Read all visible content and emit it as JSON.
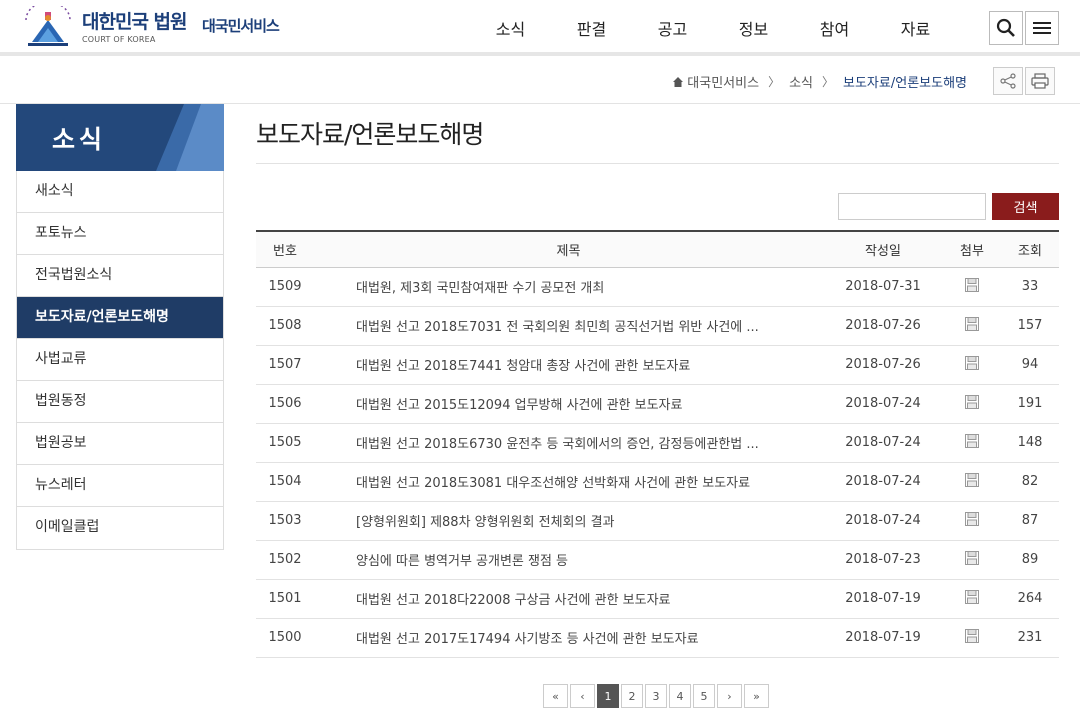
{
  "header": {
    "brand_title": "대한민국 법원",
    "brand_sub": "COURT OF KOREA",
    "service_name": "대국민서비스",
    "nav": [
      "소식",
      "판결",
      "공고",
      "정보",
      "참여",
      "자료"
    ]
  },
  "breadcrumb": {
    "home": "대국민서비스",
    "level1": "소식",
    "current": "보도자료/언론보도해명"
  },
  "sidebar": {
    "title": "소식",
    "items": [
      {
        "label": "새소식",
        "active": false
      },
      {
        "label": "포토뉴스",
        "active": false
      },
      {
        "label": "전국법원소식",
        "active": false
      },
      {
        "label": "보도자료/언론보도해명",
        "active": true
      },
      {
        "label": "사법교류",
        "active": false
      },
      {
        "label": "법원동정",
        "active": false
      },
      {
        "label": "법원공보",
        "active": false
      },
      {
        "label": "뉴스레터",
        "active": false
      },
      {
        "label": "이메일클럽",
        "active": false
      }
    ]
  },
  "main": {
    "title": "보도자료/언론보도해명",
    "search": {
      "value": "",
      "button_label": "검색"
    },
    "table": {
      "headers": [
        "번호",
        "제목",
        "작성일",
        "첨부",
        "조회"
      ],
      "rows": [
        {
          "num": "1509",
          "title": "대법원, 제3회 국민참여재판 수기 공모전 개최",
          "date": "2018-07-31",
          "views": "33"
        },
        {
          "num": "1508",
          "title": "대법원 선고 2018도7031 전 국회의원 최민희 공직선거법 위반 사건에 ...",
          "date": "2018-07-26",
          "views": "157"
        },
        {
          "num": "1507",
          "title": "대법원 선고 2018도7441 청암대 총장 사건에 관한 보도자료",
          "date": "2018-07-26",
          "views": "94"
        },
        {
          "num": "1506",
          "title": "대법원 선고 2015도12094 업무방해 사건에 관한 보도자료",
          "date": "2018-07-24",
          "views": "191"
        },
        {
          "num": "1505",
          "title": "대법원 선고 2018도6730 윤전추 등 국회에서의 증언, 감정등에관한법 ...",
          "date": "2018-07-24",
          "views": "148"
        },
        {
          "num": "1504",
          "title": "대법원 선고 2018도3081 대우조선해양 선박화재 사건에 관한 보도자료",
          "date": "2018-07-24",
          "views": "82"
        },
        {
          "num": "1503",
          "title": "[양형위원회] 제88차 양형위원회 전체회의 결과",
          "date": "2018-07-24",
          "views": "87"
        },
        {
          "num": "1502",
          "title": "양심에 따른 병역거부 공개변론 쟁점 등",
          "date": "2018-07-23",
          "views": "89"
        },
        {
          "num": "1501",
          "title": "대법원 선고 2018다22008 구상금 사건에 관한 보도자료",
          "date": "2018-07-19",
          "views": "264"
        },
        {
          "num": "1500",
          "title": "대법원 선고 2017도17494 사기방조 등 사건에 관한 보도자료",
          "date": "2018-07-19",
          "views": "231"
        }
      ]
    },
    "pagination": {
      "first": "«",
      "prev": "‹",
      "next": "›",
      "last": "»",
      "pages": [
        "1",
        "2",
        "3",
        "4",
        "5"
      ],
      "current": "1"
    }
  },
  "icons": {
    "attachment": "save-file-icon",
    "search": "search-icon",
    "menu": "hamburger-menu-icon",
    "share": "share-icon",
    "print": "printer-icon",
    "home": "home-icon"
  },
  "colors": {
    "brand": "#1c3f7a",
    "sidebar_active": "#1f3c66",
    "search_button": "#8a1c1c"
  }
}
